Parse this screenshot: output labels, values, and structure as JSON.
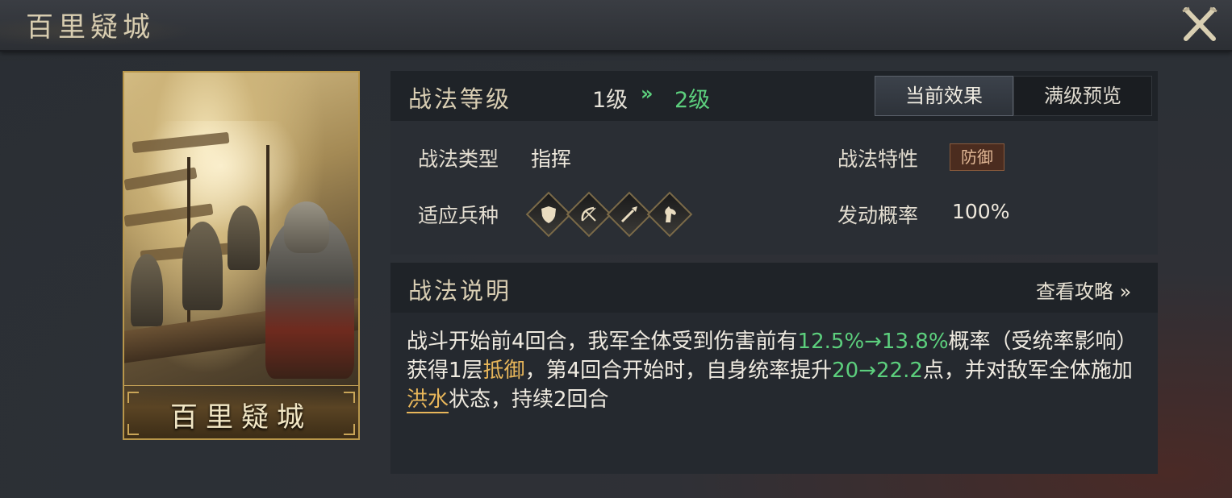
{
  "window": {
    "title": "百里疑城"
  },
  "card": {
    "name": "百里疑城"
  },
  "level": {
    "label": "战法等级",
    "current": "1级",
    "arrow": "»",
    "next": "2级",
    "tabs": [
      {
        "label": "当前效果",
        "active": true
      },
      {
        "label": "满级预览",
        "active": false
      }
    ]
  },
  "info": {
    "type_label": "战法类型",
    "type_value": "指挥",
    "trait_label": "战法特性",
    "trait_value": "防御",
    "troops_label": "适应兵种",
    "troops": [
      "shield-icon",
      "bow-icon",
      "spear-icon",
      "horse-icon"
    ],
    "chance_label": "发动概率",
    "chance_value": "100%"
  },
  "description": {
    "title": "战法说明",
    "guide_link": "查看攻略 »",
    "segments": [
      {
        "text": "战斗开始前4回合，我军全体受到伤害前有",
        "style": "normal"
      },
      {
        "text": "12.5%→13.8%",
        "style": "green"
      },
      {
        "text": "概率（受统率影响）获得1层",
        "style": "normal"
      },
      {
        "text": "抵御",
        "style": "gold"
      },
      {
        "text": "，第4回合开始时，自身统率提升",
        "style": "normal"
      },
      {
        "text": "20→22.2",
        "style": "green"
      },
      {
        "text": "点，并对敌军全体施加",
        "style": "normal"
      },
      {
        "text": "洪水",
        "style": "gold-underline"
      },
      {
        "text": "状态，持续2回合",
        "style": "normal"
      }
    ]
  },
  "colors": {
    "accent_green": "#5ccf7d",
    "accent_gold": "#e8b65a",
    "card_border": "#b8964a"
  }
}
